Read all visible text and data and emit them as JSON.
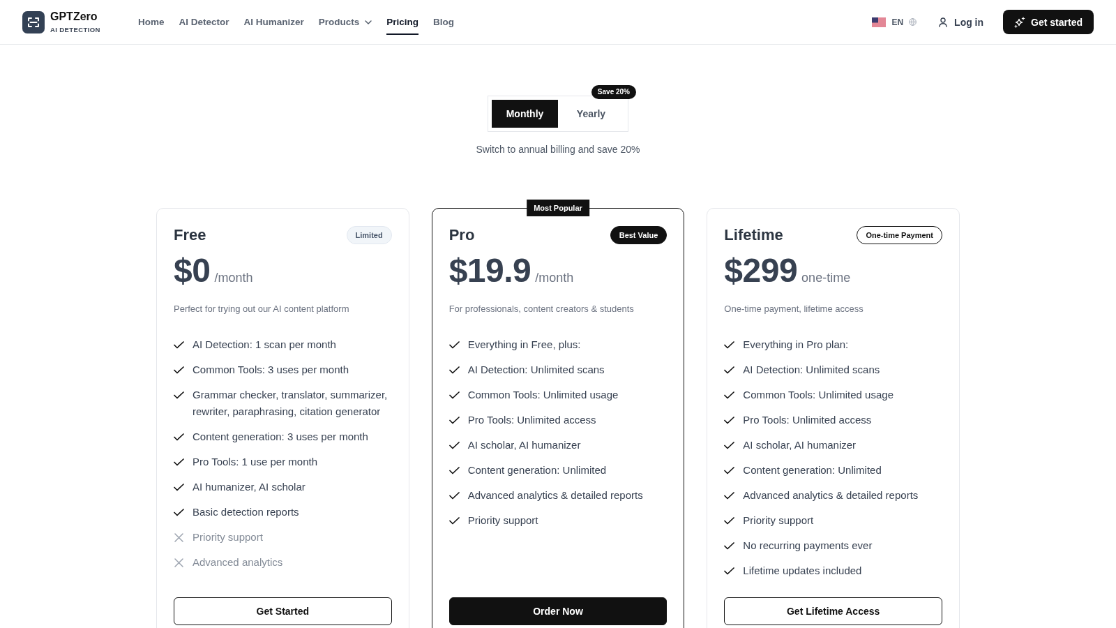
{
  "header": {
    "brand": {
      "name": "GPTZero",
      "tagline": "AI DETECTION"
    },
    "nav": [
      {
        "label": "Home",
        "selected": false,
        "dropdown": false
      },
      {
        "label": "AI Detector",
        "selected": false,
        "dropdown": false
      },
      {
        "label": "AI Humanizer",
        "selected": false,
        "dropdown": false
      },
      {
        "label": "Products",
        "selected": false,
        "dropdown": true
      },
      {
        "label": "Pricing",
        "selected": true,
        "dropdown": false
      },
      {
        "label": "Blog",
        "selected": false,
        "dropdown": false
      }
    ],
    "language": "EN",
    "login": "Log in",
    "cta": "Get started"
  },
  "billing": {
    "options": [
      {
        "label": "Monthly",
        "selected": true
      },
      {
        "label": "Yearly",
        "selected": false,
        "badge": "Save 20%"
      }
    ],
    "note": "Switch to annual billing and save 20%"
  },
  "plans": [
    {
      "name": "Free",
      "highlighted": false,
      "badge": {
        "label": "Limited",
        "kind": "muted"
      },
      "price": "$0",
      "period": "/month",
      "description": "Perfect for trying out our AI content platform",
      "features": [
        {
          "text": "AI Detection: 1 scan per month",
          "included": true
        },
        {
          "text": "Common Tools: 3 uses per month",
          "included": true
        },
        {
          "text": "Grammar checker, translator, summarizer, rewriter, paraphrasing, citation generator",
          "included": true
        },
        {
          "text": "Content generation: 3 uses per month",
          "included": true
        },
        {
          "text": "Pro Tools: 1 use per month",
          "included": true
        },
        {
          "text": "AI humanizer, AI scholar",
          "included": true
        },
        {
          "text": "Basic detection reports",
          "included": true
        },
        {
          "text": "Priority support",
          "included": false
        },
        {
          "text": "Advanced analytics",
          "included": false
        }
      ],
      "button": {
        "label": "Get Started",
        "kind": "outline"
      }
    },
    {
      "name": "Pro",
      "highlighted": true,
      "ribbon": "Most Popular",
      "badge": {
        "label": "Best Value",
        "kind": "solid"
      },
      "price": "$19.9",
      "period": "/month",
      "description": "For professionals, content creators & students",
      "features": [
        {
          "text": "Everything in Free, plus:",
          "included": true
        },
        {
          "text": "AI Detection: Unlimited scans",
          "included": true
        },
        {
          "text": "Common Tools: Unlimited usage",
          "included": true
        },
        {
          "text": "Pro Tools: Unlimited access",
          "included": true
        },
        {
          "text": "AI scholar, AI humanizer",
          "included": true
        },
        {
          "text": "Content generation: Unlimited",
          "included": true
        },
        {
          "text": "Advanced analytics & detailed reports",
          "included": true
        },
        {
          "text": "Priority support",
          "included": true
        }
      ],
      "button": {
        "label": "Order Now",
        "kind": "solid"
      }
    },
    {
      "name": "Lifetime",
      "highlighted": false,
      "badge": {
        "label": "One-time Payment",
        "kind": "outline"
      },
      "price": "$299",
      "period": "one-time",
      "description": "One-time payment, lifetime access",
      "features": [
        {
          "text": "Everything in Pro plan:",
          "included": true
        },
        {
          "text": "AI Detection: Unlimited scans",
          "included": true
        },
        {
          "text": "Common Tools: Unlimited usage",
          "included": true
        },
        {
          "text": "Pro Tools: Unlimited access",
          "included": true
        },
        {
          "text": "AI scholar, AI humanizer",
          "included": true
        },
        {
          "text": "Content generation: Unlimited",
          "included": true
        },
        {
          "text": "Advanced analytics & detailed reports",
          "included": true
        },
        {
          "text": "Priority support",
          "included": true
        },
        {
          "text": "No recurring payments ever",
          "included": true
        },
        {
          "text": "Lifetime updates included",
          "included": true
        }
      ],
      "button": {
        "label": "Get Lifetime Access",
        "kind": "outline"
      }
    }
  ]
}
